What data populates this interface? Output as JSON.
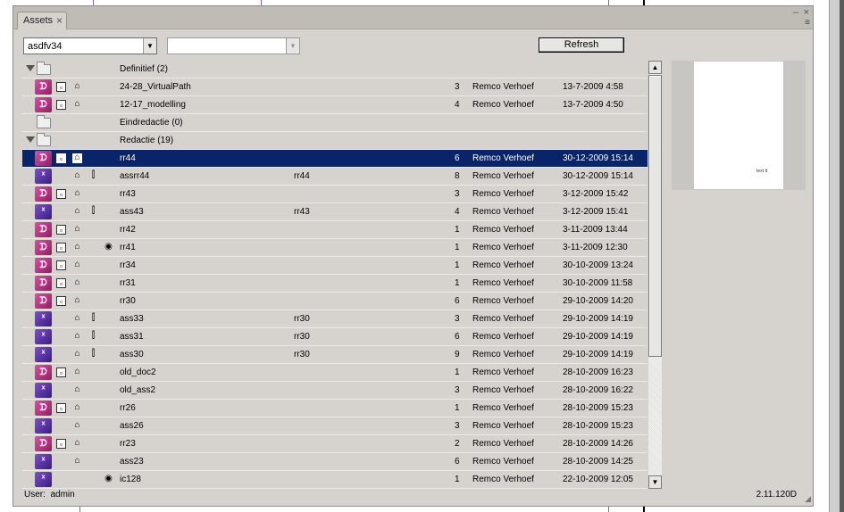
{
  "panel": {
    "tab_label": "Assets",
    "tab_close": "×",
    "minimize": "‒",
    "close": "×",
    "menu": "≡"
  },
  "toolbar": {
    "issue_select": "asdfv34",
    "secondary_select": "",
    "refresh_label": "Refresh"
  },
  "rows": [
    {
      "type": "folder",
      "name": "Definitief (2)",
      "expanded": true
    },
    {
      "type": "asset",
      "app": "indd",
      "doc": true,
      "trash": true,
      "clip": false,
      "eye": false,
      "name": "24-28_VirtualPath",
      "parent": "",
      "version": "3",
      "user": "Remco Verhoef",
      "date": "13-7-2009 4:58"
    },
    {
      "type": "asset",
      "app": "indd",
      "doc": true,
      "trash": true,
      "clip": false,
      "eye": false,
      "name": "12-17_modelling",
      "parent": "",
      "version": "4",
      "user": "Remco Verhoef",
      "date": "13-7-2009 4:50"
    },
    {
      "type": "folder",
      "name": "Eindredactie (0)",
      "expanded": false
    },
    {
      "type": "folder",
      "name": "Redactie (19)",
      "expanded": true
    },
    {
      "type": "asset",
      "app": "indd",
      "doc": true,
      "trash": true,
      "clip": false,
      "eye": false,
      "name": "rr44",
      "parent": "",
      "version": "6",
      "user": "Remco Verhoef",
      "date": "30-12-2009 15:14",
      "selected": true
    },
    {
      "type": "asset",
      "app": "incp",
      "doc": false,
      "trash": true,
      "clip": true,
      "eye": false,
      "name": "assrr44",
      "parent": "rr44",
      "version": "8",
      "user": "Remco Verhoef",
      "date": "30-12-2009 15:14"
    },
    {
      "type": "asset",
      "app": "indd",
      "doc": true,
      "trash": true,
      "clip": false,
      "eye": false,
      "name": "rr43",
      "parent": "",
      "version": "3",
      "user": "Remco Verhoef",
      "date": "3-12-2009 15:42"
    },
    {
      "type": "asset",
      "app": "incp",
      "doc": false,
      "trash": true,
      "clip": true,
      "eye": false,
      "name": "ass43",
      "parent": "rr43",
      "version": "4",
      "user": "Remco Verhoef",
      "date": "3-12-2009 15:41"
    },
    {
      "type": "asset",
      "app": "indd",
      "doc": true,
      "trash": true,
      "clip": false,
      "eye": false,
      "name": "rr42",
      "parent": "",
      "version": "1",
      "user": "Remco Verhoef",
      "date": "3-11-2009 13:44"
    },
    {
      "type": "asset",
      "app": "indd",
      "doc": true,
      "trash": true,
      "clip": false,
      "eye": true,
      "name": "rr41",
      "parent": "",
      "version": "1",
      "user": "Remco Verhoef",
      "date": "3-11-2009 12:30"
    },
    {
      "type": "asset",
      "app": "indd",
      "doc": true,
      "trash": true,
      "clip": false,
      "eye": false,
      "name": "rr34",
      "parent": "",
      "version": "1",
      "user": "Remco Verhoef",
      "date": "30-10-2009 13:24"
    },
    {
      "type": "asset",
      "app": "indd",
      "doc": true,
      "trash": true,
      "clip": false,
      "eye": false,
      "name": "rr31",
      "parent": "",
      "version": "1",
      "user": "Remco Verhoef",
      "date": "30-10-2009 11:58"
    },
    {
      "type": "asset",
      "app": "indd",
      "doc": true,
      "trash": true,
      "clip": false,
      "eye": false,
      "name": "rr30",
      "parent": "",
      "version": "6",
      "user": "Remco Verhoef",
      "date": "29-10-2009 14:20"
    },
    {
      "type": "asset",
      "app": "incp",
      "doc": false,
      "trash": true,
      "clip": true,
      "eye": false,
      "name": "ass33",
      "parent": "rr30",
      "version": "3",
      "user": "Remco Verhoef",
      "date": "29-10-2009 14:19"
    },
    {
      "type": "asset",
      "app": "incp",
      "doc": false,
      "trash": true,
      "clip": true,
      "eye": false,
      "name": "ass31",
      "parent": "rr30",
      "version": "6",
      "user": "Remco Verhoef",
      "date": "29-10-2009 14:19"
    },
    {
      "type": "asset",
      "app": "incp",
      "doc": false,
      "trash": true,
      "clip": true,
      "eye": false,
      "name": "ass30",
      "parent": "rr30",
      "version": "9",
      "user": "Remco Verhoef",
      "date": "29-10-2009 14:19"
    },
    {
      "type": "asset",
      "app": "indd",
      "doc": true,
      "trash": true,
      "clip": false,
      "eye": false,
      "name": "old_doc2",
      "parent": "",
      "version": "1",
      "user": "Remco Verhoef",
      "date": "28-10-2009 16:23"
    },
    {
      "type": "asset",
      "app": "incp",
      "doc": false,
      "trash": true,
      "clip": false,
      "eye": false,
      "name": "old_ass2",
      "parent": "",
      "version": "3",
      "user": "Remco Verhoef",
      "date": "28-10-2009 16:22"
    },
    {
      "type": "asset",
      "app": "indd",
      "doc": true,
      "trash": true,
      "clip": false,
      "eye": false,
      "name": "rr26",
      "parent": "",
      "version": "1",
      "user": "Remco Verhoef",
      "date": "28-10-2009 15:23"
    },
    {
      "type": "asset",
      "app": "incp",
      "doc": false,
      "trash": true,
      "clip": false,
      "eye": false,
      "name": "ass26",
      "parent": "",
      "version": "3",
      "user": "Remco Verhoef",
      "date": "28-10-2009 15:23"
    },
    {
      "type": "asset",
      "app": "indd",
      "doc": true,
      "trash": true,
      "clip": false,
      "eye": false,
      "name": "rr23",
      "parent": "",
      "version": "2",
      "user": "Remco Verhoef",
      "date": "28-10-2009 14:26"
    },
    {
      "type": "asset",
      "app": "incp",
      "doc": false,
      "trash": true,
      "clip": false,
      "eye": false,
      "name": "ass23",
      "parent": "",
      "version": "6",
      "user": "Remco Verhoef",
      "date": "28-10-2009 14:25"
    },
    {
      "type": "asset",
      "app": "incp",
      "doc": false,
      "trash": false,
      "clip": false,
      "eye": true,
      "name": "ic128",
      "parent": "",
      "version": "1",
      "user": "Remco Verhoef",
      "date": "22-10-2009 12:05"
    }
  ],
  "icons": {
    "indd_glyph": "ᗪ",
    "incp_glyph": "ᕽ",
    "doc_glyph": "▫",
    "trash_glyph": "⌂",
    "clip_glyph": "⫿",
    "eye_glyph": "◉"
  },
  "scroll": {
    "up": "▲",
    "down": "▼"
  },
  "preview": {
    "page_text": "text tt"
  },
  "status": {
    "user_label": "User:",
    "user_value": "admin",
    "version": "2.11.120D"
  },
  "colors": {
    "panel_bg": "#d6d3ce",
    "selection": "#0a246a",
    "indd_icon": "#c2307e",
    "incp_icon": "#5a32a8"
  }
}
